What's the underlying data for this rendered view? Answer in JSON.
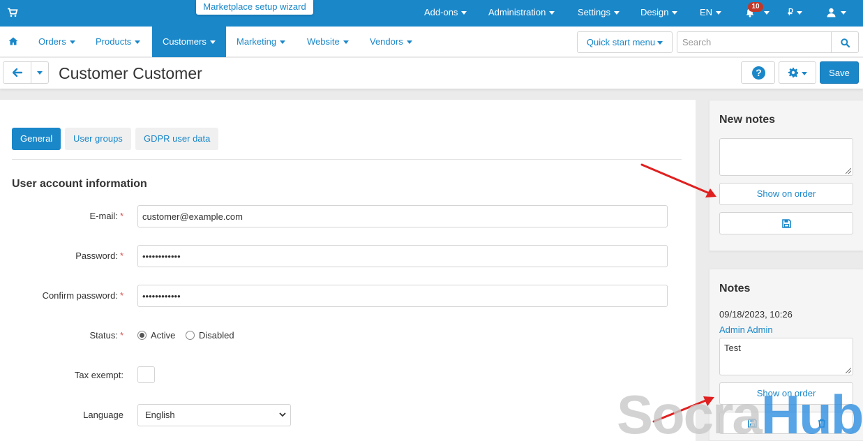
{
  "topbar": {
    "cart_icon": "cart-icon",
    "wizard_label": "Marketplace setup wizard",
    "menus": [
      {
        "label": "Add-ons"
      },
      {
        "label": "Administration"
      },
      {
        "label": "Settings"
      },
      {
        "label": "Design"
      },
      {
        "label": "EN"
      }
    ],
    "notifications_count": "10",
    "currency": "₽",
    "user_icon": "user-icon",
    "background_color": "#1a87c9"
  },
  "nav": {
    "home_icon": "home-icon",
    "items": [
      {
        "label": "Orders"
      },
      {
        "label": "Products"
      },
      {
        "label": "Customers",
        "active": true
      },
      {
        "label": "Marketing"
      },
      {
        "label": "Website"
      },
      {
        "label": "Vendors"
      }
    ],
    "quick_start_label": "Quick start menu",
    "search_placeholder": "Search"
  },
  "titlebar": {
    "title": "Customer Customer",
    "help_label": "?",
    "save_label": "Save"
  },
  "tabs": [
    {
      "label": "General",
      "active": true
    },
    {
      "label": "User groups"
    },
    {
      "label": "GDPR user data"
    }
  ],
  "form": {
    "section_title": "User account information",
    "email": {
      "label": "E-mail:",
      "value": "customer@example.com",
      "required": "*"
    },
    "password": {
      "label": "Password:",
      "value": "••••••••••••",
      "required": "*"
    },
    "confirm_password": {
      "label": "Confirm password:",
      "value": "••••••••••••",
      "required": "*"
    },
    "status": {
      "label": "Status:",
      "required": "*",
      "options": [
        "Active",
        "Disabled"
      ],
      "selected": "Active"
    },
    "tax_exempt": {
      "label": "Tax exempt:",
      "checked": false
    },
    "language": {
      "label": "Language",
      "value": "English"
    }
  },
  "new_notes": {
    "title": "New notes",
    "text": "",
    "show_on_order_label": "Show on order",
    "save_icon": "floppy-disk-icon"
  },
  "notes": {
    "title": "Notes",
    "date": "09/18/2023, 10:26",
    "author": "Admin Admin",
    "text": "Test",
    "show_on_order_label": "Show on order",
    "save_icon": "floppy-disk-icon",
    "delete_icon": "trash-icon"
  },
  "watermark": {
    "part1": "Socra",
    "part2": "Hub"
  },
  "colors": {
    "accent": "#1a87c9",
    "required": "#d9534f",
    "arrow": "#e02020"
  }
}
